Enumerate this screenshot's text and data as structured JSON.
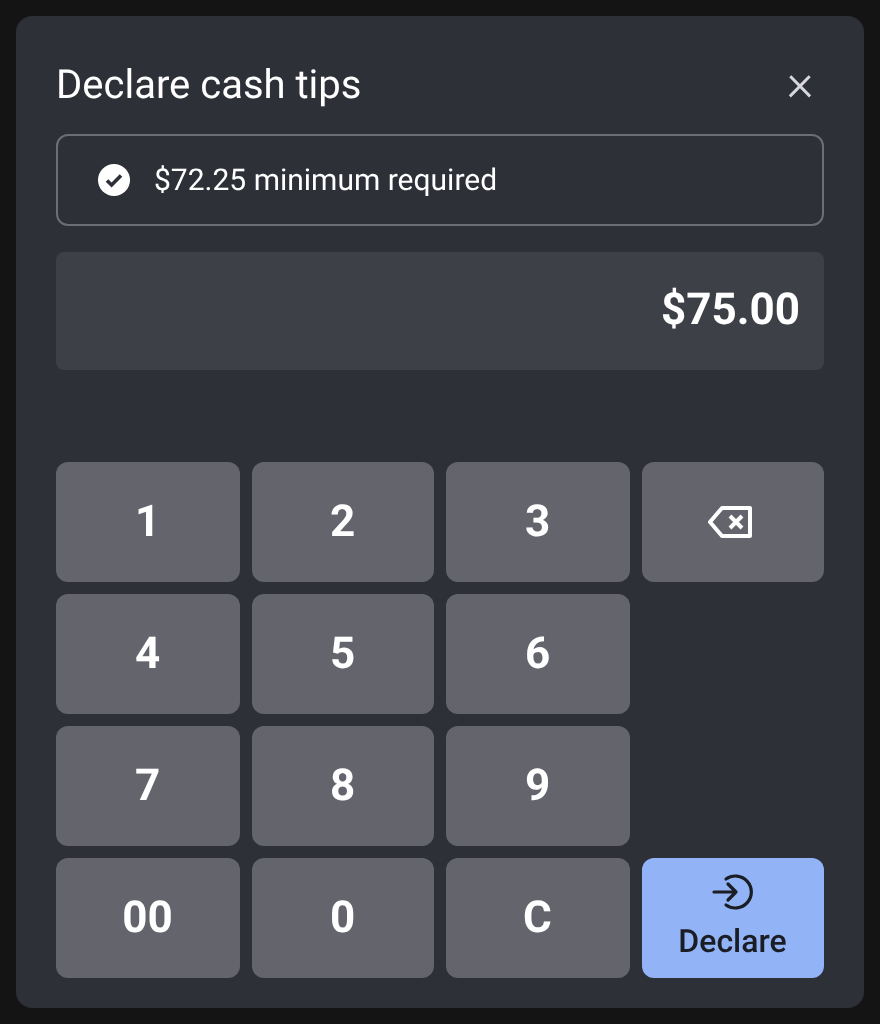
{
  "dialog": {
    "title": "Declare cash tips",
    "close_label": "×"
  },
  "notice": {
    "checked": true,
    "text": "$72.25 minimum required"
  },
  "amount": {
    "value": "$75.00"
  },
  "keypad": {
    "rows": [
      [
        {
          "kind": "digit",
          "label": "1"
        },
        {
          "kind": "digit",
          "label": "2"
        },
        {
          "kind": "digit",
          "label": "3"
        },
        {
          "kind": "backspace"
        }
      ],
      [
        {
          "kind": "digit",
          "label": "4"
        },
        {
          "kind": "digit",
          "label": "5"
        },
        {
          "kind": "digit",
          "label": "6"
        }
      ],
      [
        {
          "kind": "digit",
          "label": "7"
        },
        {
          "kind": "digit",
          "label": "8"
        },
        {
          "kind": "digit",
          "label": "9"
        }
      ],
      [
        {
          "kind": "digit",
          "label": "00"
        },
        {
          "kind": "digit",
          "label": "0"
        },
        {
          "kind": "digit",
          "label": "C"
        },
        {
          "kind": "submit",
          "label": "Declare"
        }
      ]
    ]
  }
}
